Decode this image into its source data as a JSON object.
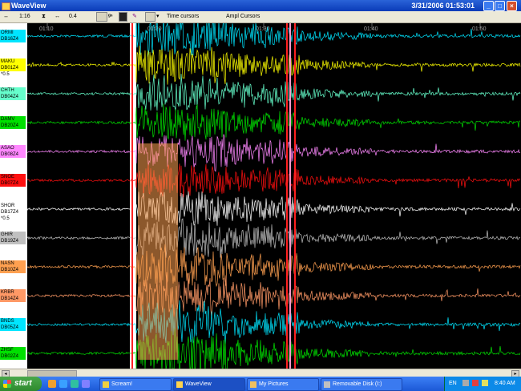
{
  "window": {
    "title": "WaveView",
    "timestamp": "3/31/2006 01:53:01",
    "min": "_",
    "max": "□",
    "close": "×"
  },
  "toolbar": {
    "zoom": "1:16",
    "spacing": "0.4",
    "time_cursors": "Time cursors",
    "ampl_cursors": "Ampl Cursors",
    "gain_label": "ᵍⁿ",
    "pen_label": "✎",
    "dropdown": "▾"
  },
  "time_axis": {
    "ticks": [
      "01:10",
      "01:20",
      "01:30",
      "01:40",
      "01:50"
    ]
  },
  "channels": [
    {
      "name": "ORMI",
      "code": "DB16Z4",
      "extra": "",
      "color": "#00e5ff"
    },
    {
      "name": "MAKU",
      "code": "DB01Z4",
      "extra": "*0.5",
      "color": "#ffff00"
    },
    {
      "name": "CHTH",
      "code": "DB04Z4",
      "extra": "",
      "color": "#66ffcc"
    },
    {
      "name": "DAMV",
      "code": "DB20Z4",
      "extra": "",
      "color": "#00e000"
    },
    {
      "name": "ASAO",
      "code": "DB08Z4",
      "extra": "",
      "color": "#ff88ff"
    },
    {
      "name": "SNOE",
      "code": "DB07Z4",
      "extra": "",
      "color": "#ff1010"
    },
    {
      "name": "SHOR",
      "code": "DB17Z4",
      "extra": "*0.5",
      "color": "#ffffff"
    },
    {
      "name": "GHIR",
      "code": "DB19Z4",
      "extra": "",
      "color": "#c0c0c0"
    },
    {
      "name": "NASN",
      "code": "DB10Z4",
      "extra": "",
      "color": "#ffa050"
    },
    {
      "name": "KRBR",
      "code": "DB14Z4",
      "extra": "",
      "color": "#ff9966"
    },
    {
      "name": "BNDS",
      "code": "DB05Z4",
      "extra": "",
      "color": "#00e5ff"
    },
    {
      "name": "ZHSF",
      "code": "DB02Z4",
      "extra": "",
      "color": "#00e000"
    }
  ],
  "taskbar": {
    "start": "start",
    "tasks": [
      "Scream!",
      "WaveView",
      "My Pictures",
      "Removable Disk (I:)"
    ],
    "lang": "EN",
    "clock": "8:40 AM"
  }
}
